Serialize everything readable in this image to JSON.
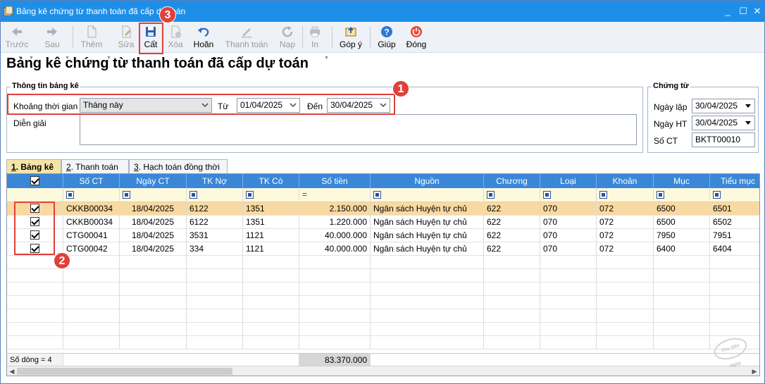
{
  "window": {
    "title": "Bảng kê chứng từ thanh toán đã cấp dự toán",
    "minimize": "_",
    "maximize": "☐",
    "close": "✕"
  },
  "toolbar": {
    "prev": "Trước",
    "next": "Sau",
    "add": "Thêm",
    "edit": "Sửa",
    "save": "Cất",
    "delete": "Xóa",
    "undo": "Hoãn",
    "pay": "Thanh toán",
    "reload": "Nạp",
    "print": "In",
    "feedback": "Góp ý",
    "help": "Giúp",
    "close": "Đóng"
  },
  "page_title": "Bảng kê chứng từ thanh toán đã cấp dự toán",
  "info_group": {
    "title": "Thông tin bảng kê",
    "period_label": "Khoảng thời gian",
    "period_value": "Tháng này",
    "from_label": "Từ",
    "from_value": "01/04/2025",
    "to_label": "Đến",
    "to_value": "30/04/2025",
    "desc_label": "Diễn giải",
    "desc_value": ""
  },
  "voucher_group": {
    "title": "Chứng từ",
    "entry_date_label": "Ngày lập",
    "entry_date_value": "30/04/2025",
    "post_date_label": "Ngày HT",
    "post_date_value": "30/04/2025",
    "number_label": "Số CT",
    "number_value": "BKTT00010"
  },
  "tabs": [
    {
      "key": "1",
      "label": ". Bảng kê"
    },
    {
      "key": "2",
      "label": ". Thanh toán"
    },
    {
      "key": "3",
      "label": ". Hạch toán đồng thời"
    }
  ],
  "grid": {
    "columns": [
      "",
      "Số CT",
      "Ngày CT",
      "TK Nợ",
      "TK Có",
      "Số tiền",
      "Nguồn",
      "Chương",
      "Loại",
      "Khoản",
      "Mục",
      "Tiểu mục"
    ],
    "rows": [
      {
        "checked": true,
        "so_ct": "CKKB00034",
        "ngay_ct": "18/04/2025",
        "tk_no": "6122",
        "tk_co": "1351",
        "so_tien": "2.150.000",
        "nguon": "Ngân sách Huyện tự chủ",
        "chuong": "622",
        "loai": "070",
        "khoan": "072",
        "muc": "6500",
        "tieu_muc": "6501"
      },
      {
        "checked": true,
        "so_ct": "CKKB00034",
        "ngay_ct": "18/04/2025",
        "tk_no": "6122",
        "tk_co": "1351",
        "so_tien": "1.220.000",
        "nguon": "Ngân sách Huyện tự chủ",
        "chuong": "622",
        "loai": "070",
        "khoan": "072",
        "muc": "6500",
        "tieu_muc": "6502"
      },
      {
        "checked": true,
        "so_ct": "CTG00041",
        "ngay_ct": "18/04/2025",
        "tk_no": "3531",
        "tk_co": "1121",
        "so_tien": "40.000.000",
        "nguon": "Ngân sách Huyện tự chủ",
        "chuong": "622",
        "loai": "070",
        "khoan": "072",
        "muc": "7950",
        "tieu_muc": "7951"
      },
      {
        "checked": true,
        "so_ct": "CTG00042",
        "ngay_ct": "18/04/2025",
        "tk_no": "334",
        "tk_co": "1121",
        "so_tien": "40.000.000",
        "nguon": "Ngân sách Huyện tự chủ",
        "chuong": "622",
        "loai": "070",
        "khoan": "072",
        "muc": "6400",
        "tieu_muc": "6404"
      }
    ],
    "row_count_label": "Số dòng = 4",
    "total": "83.370.000",
    "filter_equals": "="
  },
  "callouts": [
    "1",
    "2",
    "3"
  ],
  "stamp_text": "Thu tiền ngay",
  "colors": {
    "titlebar": "#1e8fe8",
    "header": "#3a87d8",
    "selected_row": "#f9d9a2",
    "callout": "#e0403a",
    "active_tab": "#f6e4a6"
  }
}
